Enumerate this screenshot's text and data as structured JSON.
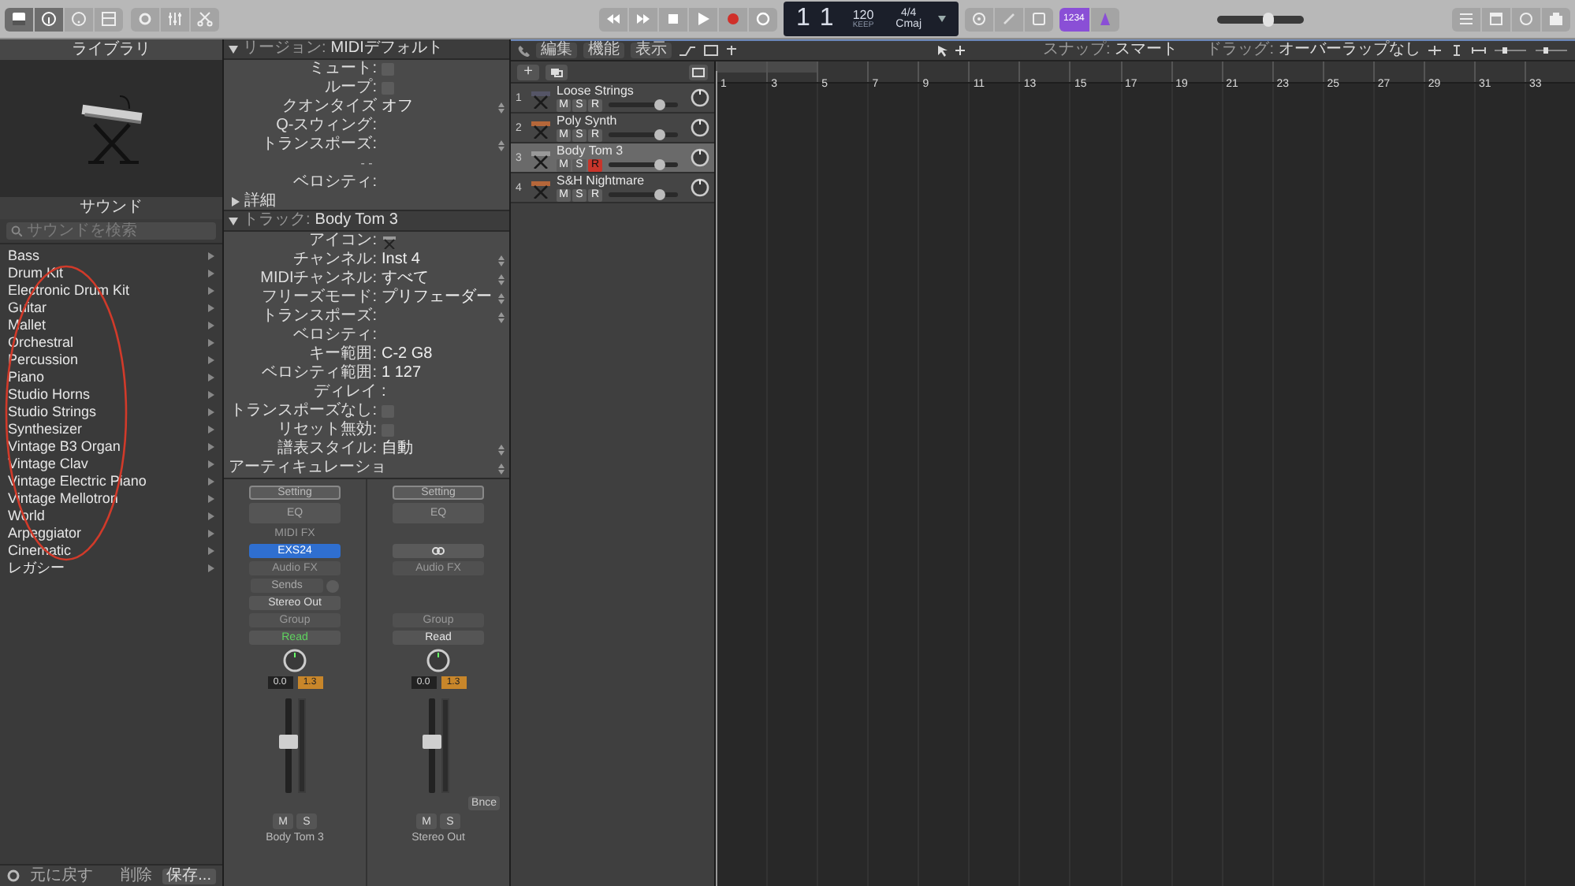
{
  "toolbar": {
    "lcd": {
      "bar": "1",
      "beat": "1",
      "tempo": "120",
      "tempo_mode": "KEEP",
      "signature": "4/4",
      "key": "Cmaj"
    },
    "count_in": "1234",
    "master_volume": {
      "level": 0.6
    }
  },
  "library": {
    "title": "ライブラリ",
    "section": "サウンド",
    "search": {
      "placeholder": "サウンドを検索"
    },
    "items": [
      {
        "label": "Bass"
      },
      {
        "label": "Drum Kit"
      },
      {
        "label": "Electronic Drum Kit"
      },
      {
        "label": "Guitar"
      },
      {
        "label": "Mallet"
      },
      {
        "label": "Orchestral"
      },
      {
        "label": "Percussion"
      },
      {
        "label": "Piano"
      },
      {
        "label": "Studio Horns"
      },
      {
        "label": "Studio Strings"
      },
      {
        "label": "Synthesizer"
      },
      {
        "label": "Vintage B3 Organ"
      },
      {
        "label": "Vintage Clav"
      },
      {
        "label": "Vintage Electric Piano"
      },
      {
        "label": "Vintage Mellotron"
      },
      {
        "label": "World"
      },
      {
        "label": "Arpeggiator"
      },
      {
        "label": "Cinematic"
      },
      {
        "label": "レガシー"
      }
    ],
    "footer": {
      "revert": "元に戻す",
      "delete": "削除",
      "save": "保存..."
    }
  },
  "region_inspector": {
    "title": "リージョン:",
    "name": "MIDIデフォルト",
    "expanded": true,
    "rows": [
      {
        "kind": "checkbox",
        "label": "ミュート:",
        "checked": false
      },
      {
        "kind": "checkbox",
        "label": "ループ:",
        "checked": false
      },
      {
        "kind": "menu",
        "label": "クオンタイズ",
        "value": "オフ"
      },
      {
        "kind": "value",
        "label": "Q-スウィング:"
      },
      {
        "kind": "menu",
        "label": "トランスポーズ:"
      },
      {
        "kind": "center",
        "label": "- -"
      },
      {
        "kind": "value",
        "label": "ベロシティ:"
      }
    ],
    "more": {
      "label": "詳細",
      "expanded": false
    }
  },
  "track_inspector": {
    "title": "トラック:",
    "name": "Body Tom 3",
    "expanded": true,
    "rows": [
      {
        "kind": "icon",
        "label": "アイコン:"
      },
      {
        "kind": "menu",
        "label": "チャンネル:",
        "value": "Inst 4"
      },
      {
        "kind": "menu",
        "label": "MIDIチャンネル:",
        "value": "すべて"
      },
      {
        "kind": "menu",
        "label": "フリーズモード:",
        "value": "プリフェーダー"
      },
      {
        "kind": "menu",
        "label": "トランスポーズ:"
      },
      {
        "kind": "value",
        "label": "ベロシティ:"
      },
      {
        "kind": "value",
        "label": "キー範囲:",
        "value": "C-2  G8"
      },
      {
        "kind": "value",
        "label": "ベロシティ範囲:",
        "value": "1  127"
      },
      {
        "kind": "value",
        "label": "ディレイ",
        "value": ":"
      },
      {
        "kind": "checkbox",
        "label": "トランスポーズなし:",
        "checked": false
      },
      {
        "kind": "checkbox",
        "label": "リセット無効:",
        "checked": false
      },
      {
        "kind": "menu",
        "label": "譜表スタイル:",
        "value": "自動"
      },
      {
        "kind": "left",
        "label": "アーティキュレーショ"
      }
    ]
  },
  "channel_strips": [
    {
      "name": "Body Tom 3",
      "link": false,
      "setting": "Setting",
      "eq": "EQ",
      "midi_fx": "MIDI FX",
      "instrument": "EXS24",
      "audio_fx": "Audio FX",
      "sends": "Sends",
      "output": "Stereo Out",
      "group": "Group",
      "automation": {
        "label": "Read",
        "color": "#5fd35f"
      },
      "volume": "0.0",
      "pan": "1.3",
      "fader": {
        "level": 0.55
      },
      "mute": "M",
      "solo": "S"
    },
    {
      "name": "Stereo Out",
      "setting": "Setting",
      "eq": "EQ",
      "link": true,
      "audio_fx": "Audio FX",
      "group": "Group",
      "automation": {
        "label": "Read",
        "color": "#e6e6e6"
      },
      "volume": "0.0",
      "pan": "1.3",
      "fader": {
        "level": 0.55
      },
      "bounce": "Bnce",
      "mute": "M",
      "solo": "S"
    }
  ],
  "tracks_toolbar": {
    "menus": [
      "編集",
      "機能",
      "表示"
    ],
    "snap": {
      "label": "スナップ:",
      "value": "スマート"
    },
    "drag": {
      "label": "ドラッグ:",
      "value": "オーバーラップなし"
    }
  },
  "track_header": {
    "add": "+"
  },
  "tracks": [
    {
      "number": "1",
      "name": "Loose Strings",
      "selected": false,
      "mute": false,
      "solo": false,
      "record": false,
      "labels": {
        "mute": "M",
        "solo": "S",
        "record": "R"
      },
      "volume": {
        "level": 0.78
      }
    },
    {
      "number": "2",
      "name": "Poly Synth",
      "selected": false,
      "mute": false,
      "solo": false,
      "record": false,
      "labels": {
        "mute": "M",
        "solo": "S",
        "record": "R"
      },
      "volume": {
        "level": 0.78
      }
    },
    {
      "number": "3",
      "name": "Body Tom 3",
      "selected": true,
      "mute": false,
      "solo": false,
      "record": true,
      "labels": {
        "mute": "M",
        "solo": "S",
        "record": "R"
      },
      "volume": {
        "level": 0.78
      }
    },
    {
      "number": "4",
      "name": "S&H Nightmare",
      "selected": false,
      "mute": false,
      "solo": false,
      "record": false,
      "labels": {
        "mute": "M",
        "solo": "S",
        "record": "R"
      },
      "volume": {
        "level": 0.78
      }
    }
  ],
  "ruler": [
    "1",
    "3",
    "5",
    "7",
    "9",
    "11",
    "13",
    "15",
    "17",
    "19",
    "21",
    "23",
    "25",
    "27",
    "29",
    "31",
    "33"
  ]
}
